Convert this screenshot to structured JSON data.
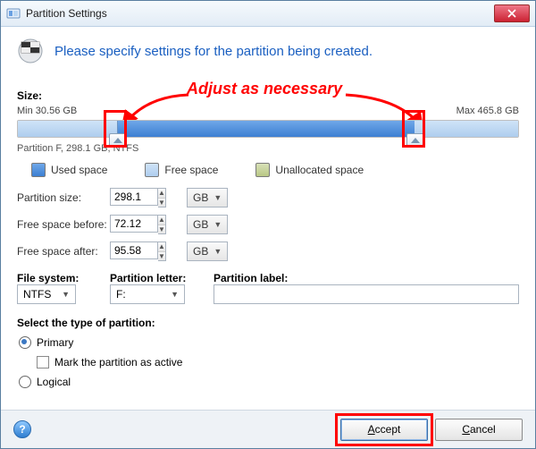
{
  "titlebar": {
    "title": "Partition Settings"
  },
  "header": {
    "instruction": "Please specify settings for the partition being created."
  },
  "annotation": {
    "text": "Adjust as necessary"
  },
  "size": {
    "label": "Size:",
    "min": "Min 30.56 GB",
    "max": "Max 465.8 GB",
    "partition_desc": "Partition F, 298.1 GB, NTFS"
  },
  "legend": {
    "used": "Used space",
    "free": "Free space",
    "unallocated": "Unallocated space"
  },
  "form": {
    "partition_size": {
      "label": "Partition size:",
      "value": "298.1",
      "unit": "GB"
    },
    "free_before": {
      "label": "Free space before:",
      "value": "72.12",
      "unit": "GB"
    },
    "free_after": {
      "label": "Free space after:",
      "value": "95.58",
      "unit": "GB"
    }
  },
  "fs": {
    "filesystem_label": "File system:",
    "letter_label": "Partition letter:",
    "label_label": "Partition label:",
    "filesystem_value": "NTFS",
    "letter_value": "F:",
    "label_value": ""
  },
  "ptype": {
    "header": "Select the type of partition:",
    "primary": "Primary",
    "mark_active": "Mark the partition as active",
    "logical": "Logical"
  },
  "footer": {
    "accept_ul": "A",
    "accept_rest": "ccept",
    "cancel_ul": "C",
    "cancel_rest": "ancel"
  }
}
